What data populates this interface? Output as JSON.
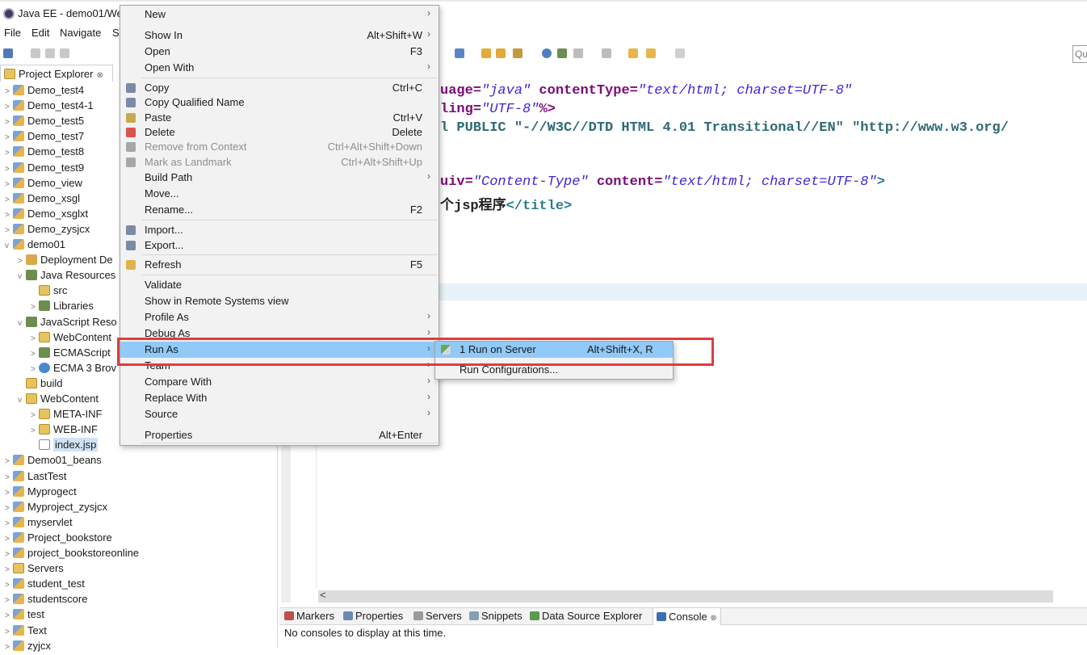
{
  "window": {
    "title": "Java EE - demo01/We"
  },
  "menubar": {
    "items": [
      "File",
      "Edit",
      "Navigate",
      "S"
    ]
  },
  "toolbar": {
    "quick_access_text": "Qu"
  },
  "explorer": {
    "tab_label": "Project Explorer",
    "close_glyph": "⊗",
    "rows": [
      {
        "label": "Demo_test4",
        "arrow": ">"
      },
      {
        "label": "Demo_test4-1",
        "arrow": ">"
      },
      {
        "label": "Demo_test5",
        "arrow": ">"
      },
      {
        "label": "Demo_test7",
        "arrow": ">"
      },
      {
        "label": "Demo_test8",
        "arrow": ">"
      },
      {
        "label": "Demo_test9",
        "arrow": ">"
      },
      {
        "label": "Demo_view",
        "arrow": ">"
      },
      {
        "label": "Demo_xsgl",
        "arrow": ">"
      },
      {
        "label": "Demo_xsglxt",
        "arrow": ">"
      },
      {
        "label": "Demo_zysjcx",
        "arrow": ">"
      },
      {
        "label": "demo01",
        "arrow": "v"
      },
      {
        "label": "Deployment De",
        "arrow": ">"
      },
      {
        "label": "Java Resources",
        "arrow": "v"
      },
      {
        "label": "src",
        "arrow": ""
      },
      {
        "label": "Libraries",
        "arrow": ">"
      },
      {
        "label": "JavaScript Reso",
        "arrow": "v"
      },
      {
        "label": "WebContent",
        "arrow": ">"
      },
      {
        "label": "ECMAScript",
        "arrow": ">"
      },
      {
        "label": "ECMA 3 Brov",
        "arrow": ">"
      },
      {
        "label": "build",
        "arrow": ""
      },
      {
        "label": "WebContent",
        "arrow": "v"
      },
      {
        "label": "META-INF",
        "arrow": ">"
      },
      {
        "label": "WEB-INF",
        "arrow": ">"
      },
      {
        "label": "index.jsp",
        "arrow": ""
      },
      {
        "label": "Demo01_beans",
        "arrow": ">"
      },
      {
        "label": "LastTest",
        "arrow": ">"
      },
      {
        "label": "Myprogect",
        "arrow": ">"
      },
      {
        "label": "Myproject_zysjcx",
        "arrow": ">"
      },
      {
        "label": "myservlet",
        "arrow": ">"
      },
      {
        "label": "Project_bookstore",
        "arrow": ">"
      },
      {
        "label": "project_bookstoreonline",
        "arrow": ">"
      },
      {
        "label": "Servers",
        "arrow": ">"
      },
      {
        "label": "student_test",
        "arrow": ">"
      },
      {
        "label": "studentscore",
        "arrow": ">"
      },
      {
        "label": "test",
        "arrow": ">"
      },
      {
        "label": "Text",
        "arrow": ">"
      },
      {
        "label": "zyjcx",
        "arrow": ">"
      }
    ]
  },
  "editor": {
    "line1": {
      "a": "uage=",
      "b": "\"java\"",
      "c": " contentType=",
      "d": "\"text/html; charset=UTF-8\""
    },
    "line2": {
      "a": "ling=",
      "b": "\"UTF-8\"",
      "c": "%>"
    },
    "line3": {
      "a": "l PUBLIC \"-//W3C//DTD HTML 4.01 Transitional//EN\" \"http://www.w3.org/"
    },
    "line4": {
      "a": "uiv=",
      "b": "\"Content-Type\"",
      "c": " content=",
      "d": "\"text/html; charset=UTF-8\"",
      "e": ">"
    },
    "line5": {
      "a": "个jsp程序",
      "b": "</title>"
    },
    "scroll_left": "<"
  },
  "context_menu": {
    "items": [
      {
        "label": "New",
        "shortcut": "",
        "arrow": "›"
      },
      {
        "label": "Show In",
        "shortcut": "Alt+Shift+W",
        "arrow": "›"
      },
      {
        "label": "Open",
        "shortcut": "F3",
        "arrow": ""
      },
      {
        "label": "Open With",
        "shortcut": "",
        "arrow": "›"
      },
      {
        "label": "Copy",
        "shortcut": "Ctrl+C",
        "arrow": ""
      },
      {
        "label": "Copy Qualified Name",
        "shortcut": "",
        "arrow": ""
      },
      {
        "label": "Paste",
        "shortcut": "Ctrl+V",
        "arrow": ""
      },
      {
        "label": "Delete",
        "shortcut": "Delete",
        "arrow": ""
      },
      {
        "label": "Remove from Context",
        "shortcut": "Ctrl+Alt+Shift+Down",
        "arrow": ""
      },
      {
        "label": "Mark as Landmark",
        "shortcut": "Ctrl+Alt+Shift+Up",
        "arrow": ""
      },
      {
        "label": "Build Path",
        "shortcut": "",
        "arrow": "›"
      },
      {
        "label": "Move...",
        "shortcut": "",
        "arrow": ""
      },
      {
        "label": "Rename...",
        "shortcut": "F2",
        "arrow": ""
      },
      {
        "label": "Import...",
        "shortcut": "",
        "arrow": ""
      },
      {
        "label": "Export...",
        "shortcut": "",
        "arrow": ""
      },
      {
        "label": "Refresh",
        "shortcut": "F5",
        "arrow": ""
      },
      {
        "label": "Validate",
        "shortcut": "",
        "arrow": ""
      },
      {
        "label": "Show in Remote Systems view",
        "shortcut": "",
        "arrow": ""
      },
      {
        "label": "Profile As",
        "shortcut": "",
        "arrow": "›"
      },
      {
        "label": "Debug As",
        "shortcut": "",
        "arrow": "›"
      },
      {
        "label": "Run As",
        "shortcut": "",
        "arrow": "›"
      },
      {
        "label": "Team",
        "shortcut": "",
        "arrow": "›"
      },
      {
        "label": "Compare With",
        "shortcut": "",
        "arrow": "›"
      },
      {
        "label": "Replace With",
        "shortcut": "",
        "arrow": "›"
      },
      {
        "label": "Source",
        "shortcut": "",
        "arrow": "›"
      },
      {
        "label": "Properties",
        "shortcut": "Alt+Enter",
        "arrow": ""
      }
    ]
  },
  "submenu": {
    "items": [
      {
        "label": "1 Run on Server",
        "shortcut": "Alt+Shift+X, R"
      },
      {
        "label": "Run Configurations...",
        "shortcut": ""
      }
    ]
  },
  "bottom_panel": {
    "tabs": [
      "Markers",
      "Properties",
      "Servers",
      "Snippets",
      "Data Source Explorer",
      "Console"
    ],
    "console_close": "⊗",
    "message": "No consoles to display at this time."
  },
  "colors": {
    "menu_highlight": "#91c9f7",
    "annotation_red": "#e03c3c",
    "selection_blue": "#cfe3f6"
  }
}
